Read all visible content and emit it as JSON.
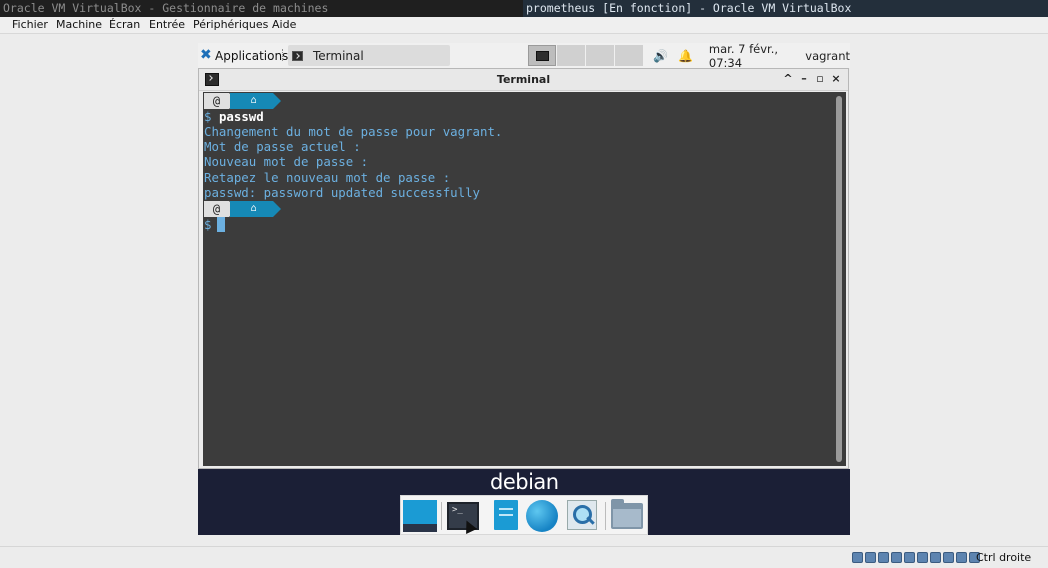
{
  "host_titles": {
    "left": "Oracle VM VirtualBox - Gestionnaire de machines",
    "right": "prometheus [En fonction] - Oracle VM VirtualBox"
  },
  "vbox_menu": [
    "Fichier",
    "Machine",
    "Écran",
    "Entrée",
    "Périphériques",
    "Aide"
  ],
  "guest_panel": {
    "applications_label": "Applications",
    "task_label": "Terminal",
    "clock": "mar.  7 févr., 07:34",
    "user": "vagrant"
  },
  "terminal": {
    "title": "Terminal",
    "controls": [
      "^",
      "–",
      "▫",
      "×"
    ],
    "prompt_icon_logo": "@",
    "prompt_icon_home": "⌂",
    "dollar": "$",
    "command": "passwd",
    "output": [
      "Changement du mot de passe pour vagrant.",
      "Mot de passe actuel :",
      "Nouveau mot de passe :",
      "Retapez le nouveau mot de passe :",
      "passwd: password updated successfully"
    ]
  },
  "desktop": {
    "logo_text": "debian"
  },
  "status_bar": {
    "host_key": "Ctrl droite"
  },
  "colors": {
    "terminal_bg": "#3c3c3c",
    "terminal_text": "#6cb0e0",
    "prompt_blue": "#1689b6",
    "desktop_bg": "#1b1f36"
  }
}
